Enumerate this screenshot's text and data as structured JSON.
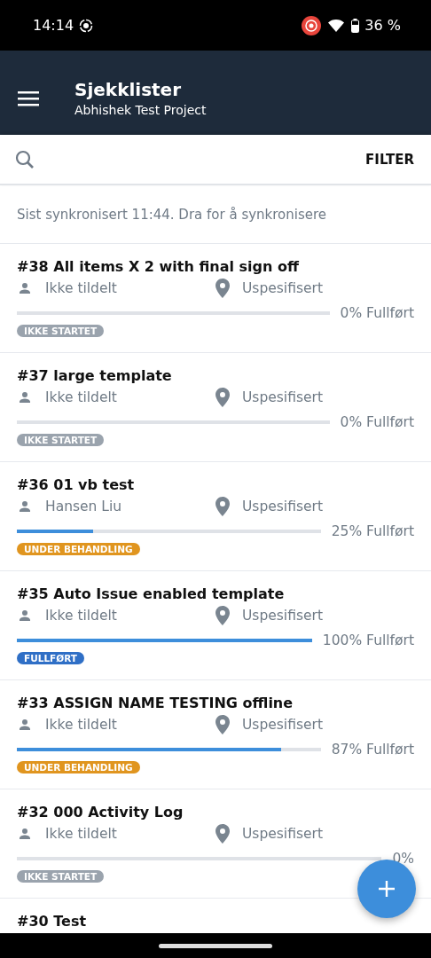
{
  "status_bar": {
    "time": "14:14",
    "battery": "36 %"
  },
  "app_bar": {
    "title": "Sjekklister",
    "subtitle": "Abhishek Test Project"
  },
  "search": {
    "filter_label": "FILTER"
  },
  "sync_note": "Sist synkronisert 11:44. Dra for å synkronisere",
  "checklists": [
    {
      "title": "**#38** All items X 2 with final sign off",
      "assignee": "Ikke tildelt",
      "location": "Uspesifisert",
      "level": 0,
      "progress": "0% Fullført",
      "kind": "not_started",
      "status_label": "IKKE STARTET"
    },
    {
      "title": "**#37** large template",
      "assignee": "Ikke tildelt",
      "location": "Uspesifisert",
      "level": 0,
      "progress": "0% Fullført",
      "kind": "not_started",
      "status_label": "IKKE STARTET"
    },
    {
      "title": "**#36** 01 vb test",
      "assignee": "Hansen Liu",
      "location": "Uspesifisert",
      "level": 0.25,
      "progress": "25% Fullført",
      "kind": "in_progress",
      "status_label": "UNDER BEHANDLING"
    },
    {
      "title": "**#35** Auto Issue enabled template",
      "assignee": "Ikke tildelt",
      "location": "Uspesifisert",
      "level": 1,
      "progress": "100% Fullført",
      "kind": "done",
      "status_label": "FULLFØRT"
    },
    {
      "title": "**#33** ASSIGN NAME TESTING offline",
      "assignee": "Ikke tildelt",
      "location": "Uspesifisert",
      "level": 0.87,
      "progress": "87% Fullført",
      "kind": "in_progress",
      "status_label": "UNDER BEHANDLING"
    },
    {
      "title": "**#32** 000 Activity Log",
      "assignee": "Ikke tildelt",
      "location": "Uspesifisert",
      "level": 0,
      "progress": "0%",
      "kind": "not_started",
      "status_label": "IKKE STARTET"
    },
    {
      "title": "**#30** Test"
    }
  ]
}
